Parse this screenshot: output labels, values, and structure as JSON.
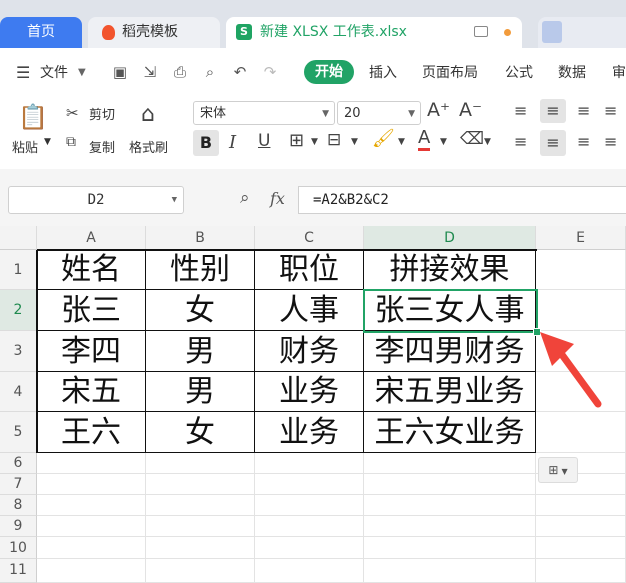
{
  "tabs": {
    "home": "首页",
    "template": "稻壳模板",
    "document": "新建 XLSX 工作表.xlsx",
    "document_icon_letter": "S"
  },
  "menu": {
    "file": "文件",
    "items": [
      "开始",
      "插入",
      "页面布局",
      "公式",
      "数据",
      "审"
    ]
  },
  "ribbon": {
    "paste": "粘贴",
    "cut": "剪切",
    "copy": "复制",
    "format_painter": "格式刷",
    "font_name": "宋体",
    "font_size": "20",
    "bold": "B",
    "italic": "I",
    "underline": "U",
    "font_color_glyph": "A",
    "grow_font": "A⁺",
    "shrink_font": "A⁻"
  },
  "formula_bar": {
    "name_box": "D2",
    "fx": "fx",
    "formula": "=A2&B2&C2"
  },
  "sheet": {
    "columns": [
      "A",
      "B",
      "C",
      "D",
      "E"
    ],
    "rows": [
      "1",
      "2",
      "3",
      "4",
      "5",
      "6",
      "7",
      "8",
      "9",
      "10",
      "11"
    ],
    "table": [
      [
        "姓名",
        "性别",
        "职位",
        "拼接效果"
      ],
      [
        "张三",
        "女",
        "人事",
        "张三女人事"
      ],
      [
        "李四",
        "男",
        "财务",
        "李四男财务"
      ],
      [
        "宋五",
        "男",
        "业务",
        "宋五男业务"
      ],
      [
        "王六",
        "女",
        "业务",
        "王六女业务"
      ]
    ],
    "selected_cell": "D2"
  },
  "colors": {
    "accent_green": "#21a366",
    "home_tab_blue": "#3e7bf0",
    "arrow_red": "#f0443a"
  }
}
